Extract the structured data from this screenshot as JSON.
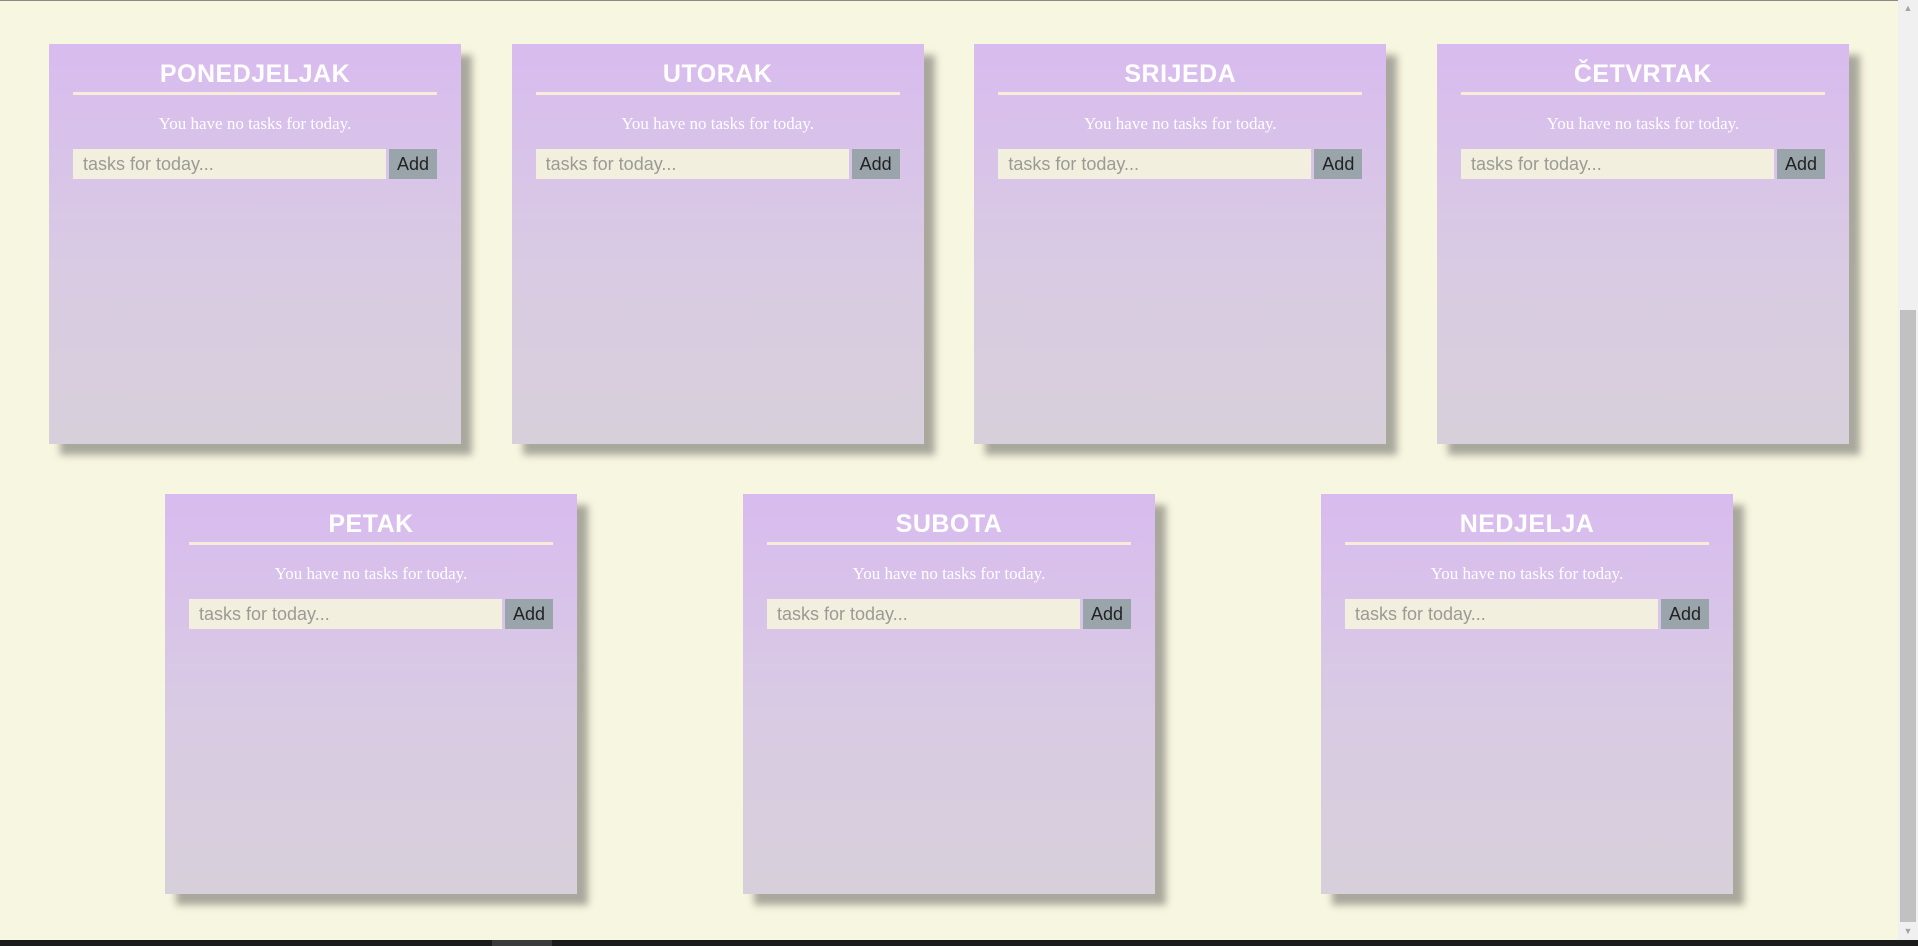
{
  "days": [
    {
      "title": "PONEDJELJAK",
      "message": "You have no tasks for today.",
      "placeholder": "tasks for today...",
      "button": "Add"
    },
    {
      "title": "UTORAK",
      "message": "You have no tasks for today.",
      "placeholder": "tasks for today...",
      "button": "Add"
    },
    {
      "title": "SRIJEDA",
      "message": "You have no tasks for today.",
      "placeholder": "tasks for today...",
      "button": "Add"
    },
    {
      "title": "ČETVRTAK",
      "message": "You have no tasks for today.",
      "placeholder": "tasks for today...",
      "button": "Add"
    },
    {
      "title": "PETAK",
      "message": "You have no tasks for today.",
      "placeholder": "tasks for today...",
      "button": "Add"
    },
    {
      "title": "SUBOTA",
      "message": "You have no tasks for today.",
      "placeholder": "tasks for today...",
      "button": "Add"
    },
    {
      "title": "NEDJELJA",
      "message": "You have no tasks for today.",
      "placeholder": "tasks for today...",
      "button": "Add"
    }
  ],
  "scrollbar": {
    "up_icon": "scroll-up-arrow-icon",
    "down_icon": "scroll-down-arrow-icon"
  },
  "colors": {
    "page_background": "#f7f6e0",
    "card_gradient_top": "#d8bbef",
    "card_gradient_bottom": "#d7d0da",
    "title_text": "#ffffff",
    "title_underline": "#f6ecd9",
    "input_background": "#f3efdf",
    "add_button": "#9aa5ab"
  }
}
